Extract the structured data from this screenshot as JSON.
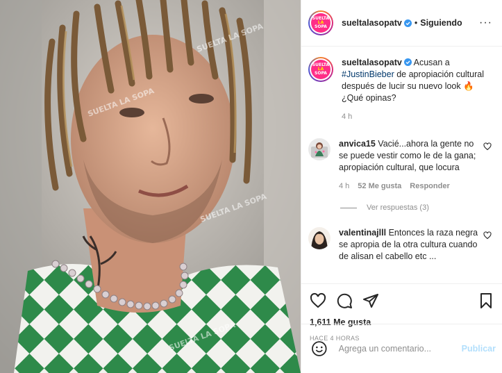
{
  "post": {
    "username": "sueltalasopatv",
    "separator": "•",
    "follow_status": "Siguiendo",
    "more_label": "···",
    "avatar_text_top": "SUELTA",
    "avatar_text_mid": "LA",
    "avatar_text_bot": "SOPA"
  },
  "caption": {
    "username": "sueltalasopatv",
    "text_before": " Acusan a ",
    "hashtag": "#JustinBieber",
    "text_after": " de apropiación cultural después de lucir su nuevo look ",
    "emoji": "🔥",
    "text_end": " ¿Qué opinas?",
    "time": "4 h"
  },
  "comments": [
    {
      "username": "anvica15",
      "text": " Vacié...ahora la gente no se puede vestir como le de la gana; apropiación cultural, que locura",
      "time": "4 h",
      "likes": "52 Me gusta",
      "reply": "Responder",
      "view_replies": "Ver respuestas (3)"
    },
    {
      "username": "valentinajlll",
      "text": " Entonces la raza negra se apropia de la otra cultura cuando de alisan el cabello etc ..."
    }
  ],
  "actions": {
    "likes": "1,611 Me gusta",
    "timestamp": "HACE 4 HORAS"
  },
  "composer": {
    "placeholder": "Agrega un comentario...",
    "post_label": "Publicar"
  },
  "photo": {
    "watermark": "SUELTA LA SOPA"
  },
  "colors": {
    "accent": "#0095f6",
    "post_disabled": "#b2dffc",
    "link": "#00376b",
    "muted": "#8e8e8e",
    "brand_pink": "#ff2d87",
    "brand_yellow": "#ffe600",
    "jersey_green": "#2e8a4a"
  }
}
